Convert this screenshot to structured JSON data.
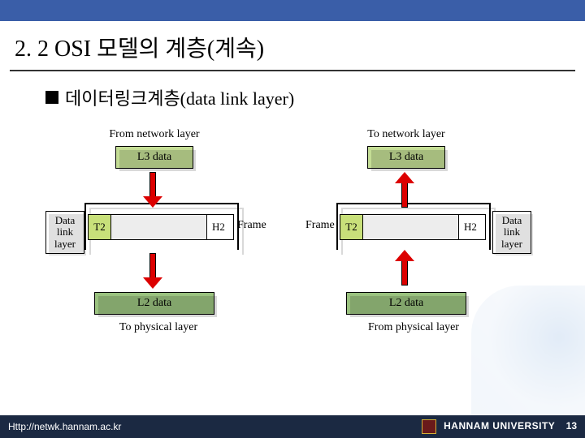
{
  "header": {
    "title": "2. 2 OSI 모델의 계층(계속)",
    "subtitle": "데이터링크계층(data link layer)"
  },
  "diagram": {
    "left": {
      "top_label": "From network layer",
      "l3": "L3 data",
      "side_label": "Data\nlink\nlayer",
      "frame": {
        "t2": "T2",
        "h2": "H2",
        "caption": "Frame"
      },
      "l2": "L2 data",
      "bottom_label": "To physical layer",
      "arrow_direction": "down"
    },
    "right": {
      "top_label": "To network layer",
      "l3": "L3 data",
      "side_label": "Data\nlink\nlayer",
      "frame": {
        "t2": "T2",
        "h2": "H2",
        "caption": "Frame"
      },
      "l2": "L2 data",
      "bottom_label": "From physical layer",
      "arrow_direction": "up"
    }
  },
  "footer": {
    "url": "Http://netwk.hannam.ac.kr",
    "university": "HANNAM  UNIVERSITY",
    "page": "13"
  }
}
